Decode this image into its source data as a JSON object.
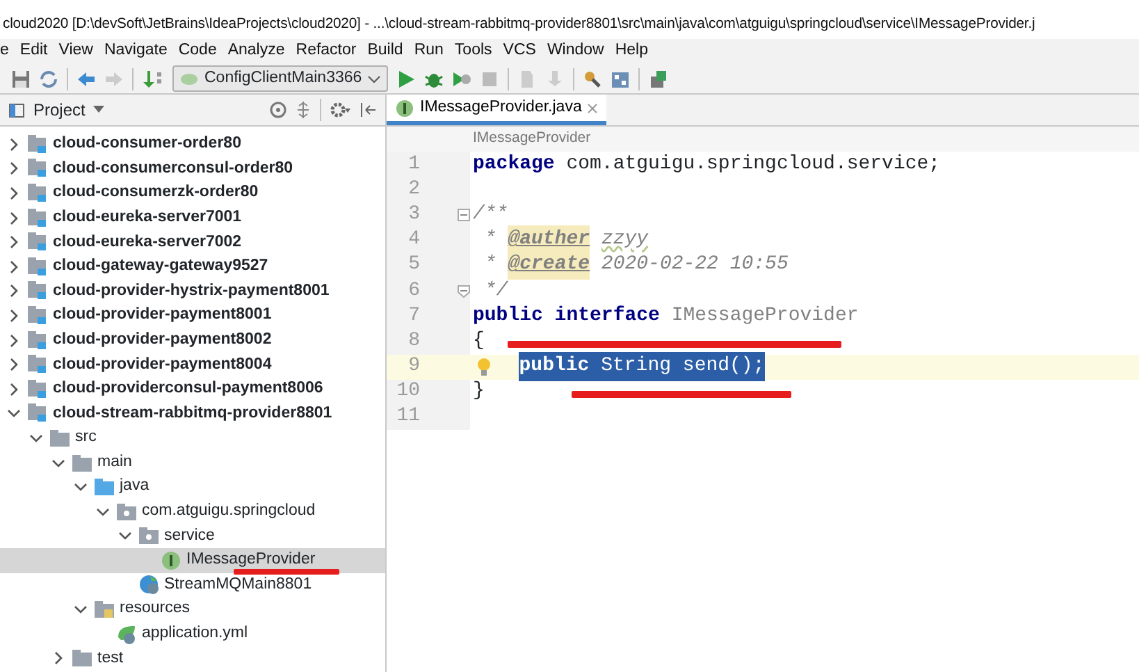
{
  "window": {
    "title": "cloud2020 [D:\\devSoft\\JetBrains\\IdeaProjects\\cloud2020] - ...\\cloud-stream-rabbitmq-provider8801\\src\\main\\java\\com\\atguigu\\springcloud\\service\\IMessageProvider.j"
  },
  "menu": [
    "e",
    "Edit",
    "View",
    "Navigate",
    "Code",
    "Analyze",
    "Refactor",
    "Build",
    "Run",
    "Tools",
    "VCS",
    "Window",
    "Help"
  ],
  "toolbar": {
    "run_config": "ConfigClientMain3366"
  },
  "project_panel": {
    "title": "Project",
    "tree": [
      {
        "label": "cloud-consumer-order80",
        "kind": "module",
        "expanded": false,
        "selected": false
      },
      {
        "label": "cloud-consumerconsul-order80",
        "kind": "module",
        "expanded": false,
        "selected": false
      },
      {
        "label": "cloud-consumerzk-order80",
        "kind": "module",
        "expanded": false,
        "selected": false
      },
      {
        "label": "cloud-eureka-server7001",
        "kind": "module",
        "expanded": false,
        "selected": false
      },
      {
        "label": "cloud-eureka-server7002",
        "kind": "module",
        "expanded": false,
        "selected": false
      },
      {
        "label": "cloud-gateway-gateway9527",
        "kind": "module",
        "expanded": false,
        "selected": false
      },
      {
        "label": "cloud-provider-hystrix-payment8001",
        "kind": "module",
        "expanded": false,
        "selected": false
      },
      {
        "label": "cloud-provider-payment8001",
        "kind": "module",
        "expanded": false,
        "selected": false
      },
      {
        "label": "cloud-provider-payment8002",
        "kind": "module",
        "expanded": false,
        "selected": false
      },
      {
        "label": "cloud-provider-payment8004",
        "kind": "module",
        "expanded": false,
        "selected": false
      },
      {
        "label": "cloud-providerconsul-payment8006",
        "kind": "module",
        "expanded": false,
        "selected": false
      },
      {
        "label": "cloud-stream-rabbitmq-provider8801",
        "kind": "module",
        "expanded": true,
        "selected": false,
        "children": [
          {
            "label": "src",
            "kind": "folder",
            "expanded": true,
            "selected": false,
            "children": [
              {
                "label": "main",
                "kind": "folder",
                "expanded": true,
                "selected": false,
                "children": [
                  {
                    "label": "java",
                    "kind": "source",
                    "expanded": true,
                    "selected": false,
                    "children": [
                      {
                        "label": "com.atguigu.springcloud",
                        "kind": "package",
                        "expanded": true,
                        "selected": false,
                        "children": [
                          {
                            "label": "service",
                            "kind": "package",
                            "expanded": true,
                            "selected": false,
                            "children": [
                              {
                                "label": "IMessageProvider",
                                "kind": "interface",
                                "selected": true
                              }
                            ]
                          },
                          {
                            "label": "StreamMQMain8801",
                            "kind": "spring-class",
                            "selected": false
                          }
                        ]
                      }
                    ]
                  },
                  {
                    "label": "resources",
                    "kind": "resources",
                    "expanded": true,
                    "selected": false,
                    "children": [
                      {
                        "label": "application.yml",
                        "kind": "yml",
                        "selected": false
                      }
                    ]
                  }
                ]
              },
              {
                "label": "test",
                "kind": "folder",
                "expanded": false,
                "selected": false
              }
            ]
          }
        ]
      }
    ]
  },
  "editor": {
    "tab": {
      "label": "IMessageProvider.java",
      "selected": true
    },
    "breadcrumb": "IMessageProvider",
    "lines": [
      {
        "number": "1",
        "tokens": [
          {
            "text": "package",
            "kind": "keyword"
          },
          {
            "text": " com.atguigu.springcloud.service;",
            "kind": "plain"
          }
        ]
      },
      {
        "number": "2"
      },
      {
        "number": "3",
        "fold_start": true,
        "tokens": [
          {
            "text": "/**",
            "kind": "comment"
          }
        ]
      },
      {
        "number": "4",
        "tokens": [
          {
            "text": " * ",
            "kind": "comment"
          },
          {
            "text": "@auther",
            "kind": "doc-tag"
          },
          {
            "text": " zzyy",
            "kind": "doc-value"
          }
        ]
      },
      {
        "number": "5",
        "tokens": [
          {
            "text": " * ",
            "kind": "comment"
          },
          {
            "text": "@create",
            "kind": "doc-tag"
          },
          {
            "text": " 2020-02-22 10:55",
            "kind": "comment"
          }
        ]
      },
      {
        "number": "6",
        "fold_end": true,
        "tokens": [
          {
            "text": " */",
            "kind": "comment"
          }
        ]
      },
      {
        "number": "7",
        "tokens": [
          {
            "text": "public interface",
            "kind": "keyword"
          },
          {
            "text": " IMessageProvider",
            "kind": "unused"
          }
        ]
      },
      {
        "number": "8",
        "tokens": [
          {
            "text": "{",
            "kind": "plain"
          }
        ]
      },
      {
        "number": "9",
        "current": true,
        "bulb": true,
        "selected": true,
        "indented": true,
        "tokens": [
          {
            "text": "public",
            "kind": "keyword"
          },
          {
            "text": " String send();",
            "kind": "plain"
          }
        ]
      },
      {
        "number": "10",
        "tokens": [
          {
            "text": "}",
            "kind": "plain"
          }
        ]
      },
      {
        "number": "11"
      }
    ]
  }
}
